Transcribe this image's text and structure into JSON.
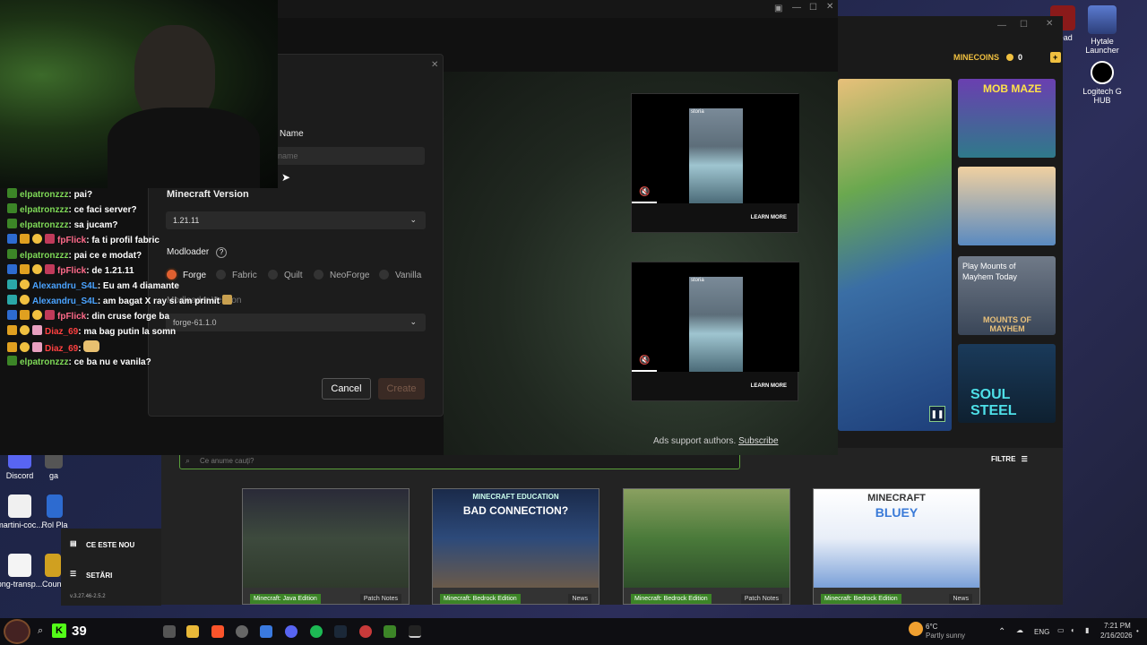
{
  "colors": {
    "accent_green": "#3c8527",
    "coin_gold": "#f0c040",
    "chat_green": "#7ed957",
    "chat_blue": "#4aa3ff",
    "chat_pink": "#ff6a8a",
    "chat_red": "#ff4040"
  },
  "desktop_icons": [
    {
      "label": "Hytale Launcher",
      "icon": "hytale-icon"
    },
    {
      "label": "Logitech G HUB",
      "icon": "logitech-icon"
    },
    {
      "label": "Discord",
      "icon": "discord-icon"
    },
    {
      "label": "martini-coc...",
      "icon": "file-icon"
    },
    {
      "label": "png-transp...",
      "icon": "file-icon"
    },
    {
      "label": "Dead",
      "icon": "game-icon"
    },
    {
      "label": "ga",
      "icon": "game-icon"
    },
    {
      "label": "Rol Pla",
      "icon": "game-icon"
    },
    {
      "label": "Count",
      "icon": "game-icon"
    }
  ],
  "minecraft_launcher": {
    "minecoins_label": "MINECOINS",
    "minecoins_value": "0",
    "search_placeholder": "Ce anume cauți?",
    "filter_label": "FILTRE",
    "sidebar": [
      {
        "label": "CE ESTE NOU",
        "icon": "news-icon"
      },
      {
        "label": "SETĂRI",
        "icon": "settings-icon"
      }
    ],
    "version": "v.3.27.46-2.5.2",
    "promo_tiles": [
      {
        "title": "MOB MAZE"
      },
      {
        "title": "Play Mounts of Mayhem Today"
      },
      {
        "title": "MOUNTS OF MAYHEM"
      },
      {
        "title": "SOUL STEEL"
      }
    ],
    "news_cards": [
      {
        "tag": "Minecraft: Java Edition",
        "type": "Patch Notes",
        "art_text": ""
      },
      {
        "tag": "Minecraft: Bedrock Edition",
        "type": "News",
        "art_text": "BAD CONNECTION?",
        "art_sub": "MINECRAFT EDUCATION"
      },
      {
        "tag": "Minecraft: Bedrock Edition",
        "type": "Patch Notes",
        "art_text": ""
      },
      {
        "tag": "Minecraft: Bedrock Edition",
        "type": "News",
        "art_text": "BLUEY",
        "art_sub": "MINECRAFT"
      }
    ]
  },
  "create_dialog": {
    "name_label": "Name",
    "name_placeholder": "name",
    "version_label": "Minecraft Version",
    "version_value": "1.21.11",
    "modloader_label": "Modloader",
    "modloaders": [
      "Forge",
      "Fabric",
      "Quilt",
      "NeoForge",
      "Vanilla"
    ],
    "selected_modloader": "Forge",
    "loader_version_label": "Modloader Version",
    "loader_version_value": "forge-61.1.0",
    "cancel_label": "Cancel",
    "create_label": "Create"
  },
  "ads": {
    "brand": "storia",
    "learn_more": "LEARN MORE",
    "support_text": "Ads support authors.",
    "subscribe_link": "Subscribe"
  },
  "chat": [
    {
      "user": "elpatronzzz",
      "color": "#7ed957",
      "message": "pai?",
      "badges": [
        "green"
      ]
    },
    {
      "user": "elpatronzzz",
      "color": "#7ed957",
      "message": "ce faci server?",
      "badges": [
        "green"
      ]
    },
    {
      "user": "elpatronzzz",
      "color": "#7ed957",
      "message": "sa jucam?",
      "badges": [
        "green"
      ]
    },
    {
      "user": "fpFlick",
      "color": "#ff6a8a",
      "message": "fa ti profil fabric",
      "badges": [
        "blue",
        "gold",
        "coin",
        "pink"
      ]
    },
    {
      "user": "elpatronzzz",
      "color": "#7ed957",
      "message": "pai ce e modat?",
      "badges": [
        "green"
      ]
    },
    {
      "user": "fpFlick",
      "color": "#ff6a8a",
      "message": "de 1.21.11",
      "badges": [
        "blue",
        "gold",
        "coin",
        "pink"
      ]
    },
    {
      "user": "Alexandru_S4L",
      "color": "#4aa3ff",
      "message": "Eu am 4 diamante",
      "badges": [
        "teal",
        "coin"
      ]
    },
    {
      "user": "Alexandru_S4L",
      "color": "#4aa3ff",
      "message": "am bagat X ray si am primit",
      "badges": [
        "teal",
        "coin"
      ]
    },
    {
      "user": "fpFlick",
      "color": "#ff6a8a",
      "message": "din cruse forge ba",
      "badges": [
        "blue",
        "gold",
        "coin",
        "pink"
      ]
    },
    {
      "user": "Diaz_69",
      "color": "#ff4040",
      "message": "ma bag putin la somn",
      "badges": [
        "gold",
        "coin",
        "gift"
      ]
    },
    {
      "user": "Diaz_69",
      "color": "#ff4040",
      "message": "",
      "badges": [
        "gold",
        "coin",
        "gift"
      ]
    },
    {
      "user": "elpatronzzz",
      "color": "#7ed957",
      "message": "ce ba nu e vanila?",
      "badges": [
        "green"
      ]
    }
  ],
  "taskbar": {
    "viewer_count": "39",
    "weather_temp": "6°C",
    "weather_desc": "Partly sunny",
    "lang": "ENG",
    "time": "7:21 PM",
    "date": "2/16/2026"
  }
}
